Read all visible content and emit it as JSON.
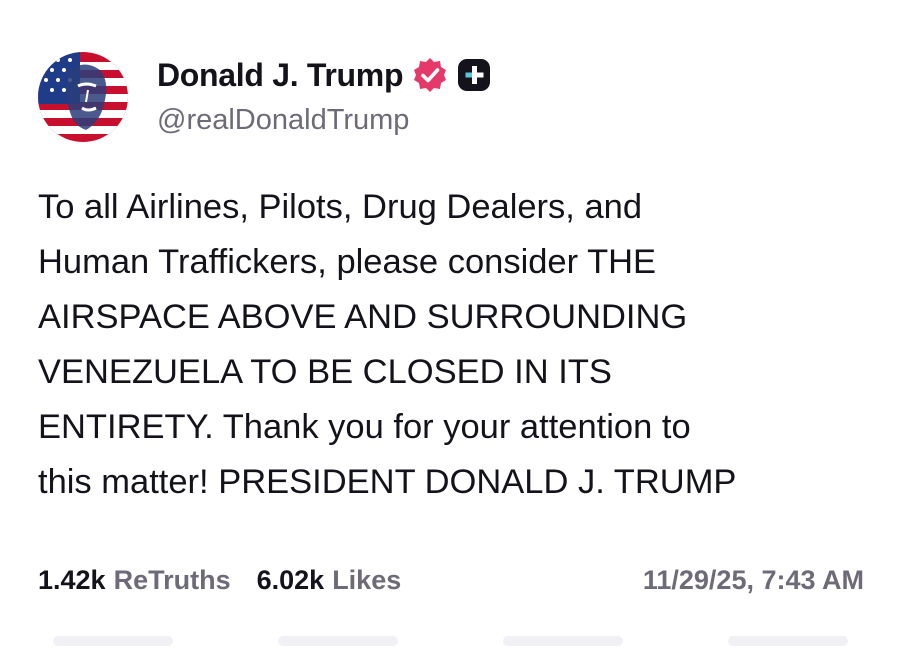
{
  "author": {
    "display_name": "Donald J. Trump",
    "handle": "@realDonaldTrump",
    "avatar_icon": "flag-portrait-avatar",
    "verified_icon": "verified-badge-icon",
    "plus_icon": "plus-badge-icon"
  },
  "post": {
    "text": "To all Airlines, Pilots, Drug Dealers, and\nHuman Traffickers, please consider THE\nAIRSPACE ABOVE AND SURROUNDING\nVENEZUELA TO BE CLOSED IN ITS\nENTIRETY. Thank you for your attention to\nthis matter! PRESIDENT DONALD J. TRUMP"
  },
  "stats": {
    "retruths_count": "1.42k",
    "retruths_label": "ReTruths",
    "likes_count": "6.02k",
    "likes_label": "Likes",
    "timestamp": "11/29/25, 7:43 AM"
  },
  "colors": {
    "text": "#14121a",
    "muted": "#6e6a78",
    "verified": "#e5396a",
    "badge": "#14121a"
  }
}
